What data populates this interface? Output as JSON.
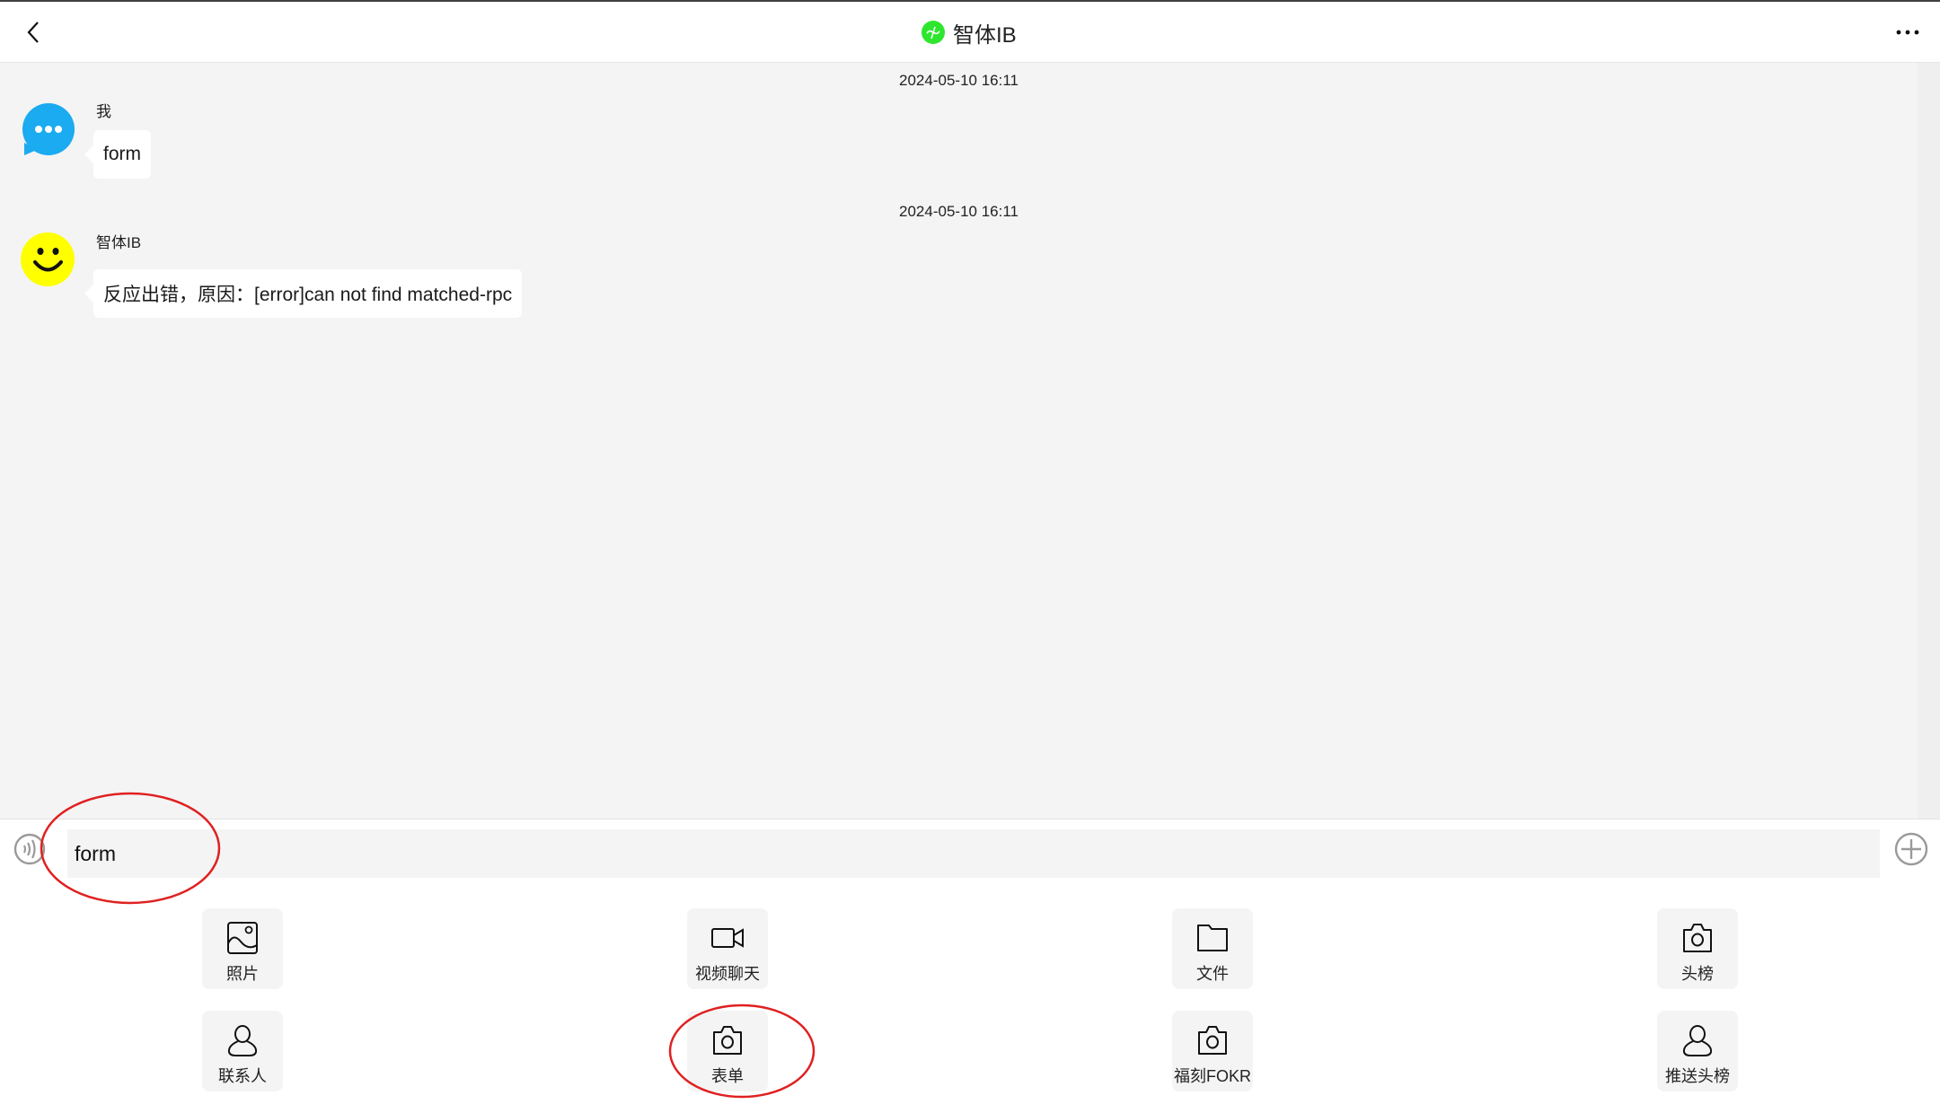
{
  "header": {
    "title": "智体IB",
    "back_icon": "chevron-left-icon",
    "more_icon": "more-horizontal-icon",
    "title_icon_color": "#2ee62e"
  },
  "messages": [
    {
      "timestamp": "2024-05-10 16:11",
      "sender": "我",
      "avatar": "chat-bubble-avatar",
      "avatar_color": "#1aabf0",
      "text": "form"
    },
    {
      "timestamp": "2024-05-10 16:11",
      "sender": "智体IB",
      "avatar": "smiley-avatar",
      "avatar_color": "#ffff00",
      "text": "反应出错，原因：[error]can not find matched-rpc"
    }
  ],
  "composer": {
    "input_value": "form",
    "voice_icon": "voice-icon",
    "plus_icon": "plus-circle-icon"
  },
  "actions": [
    {
      "label": "照片",
      "icon": "image-icon"
    },
    {
      "label": "视频聊天",
      "icon": "video-camera-icon"
    },
    {
      "label": "文件",
      "icon": "folder-icon"
    },
    {
      "label": "头榜",
      "icon": "camera-icon"
    },
    {
      "label": "联系人",
      "icon": "person-icon"
    },
    {
      "label": "表单",
      "icon": "camera-icon"
    },
    {
      "label": "福刻FOKR",
      "icon": "camera-icon"
    },
    {
      "label": "推送头榜",
      "icon": "person-icon"
    }
  ],
  "annotations": {
    "highlight_color": "#e02020",
    "highlighted": [
      "input-field",
      "action-表单"
    ]
  }
}
